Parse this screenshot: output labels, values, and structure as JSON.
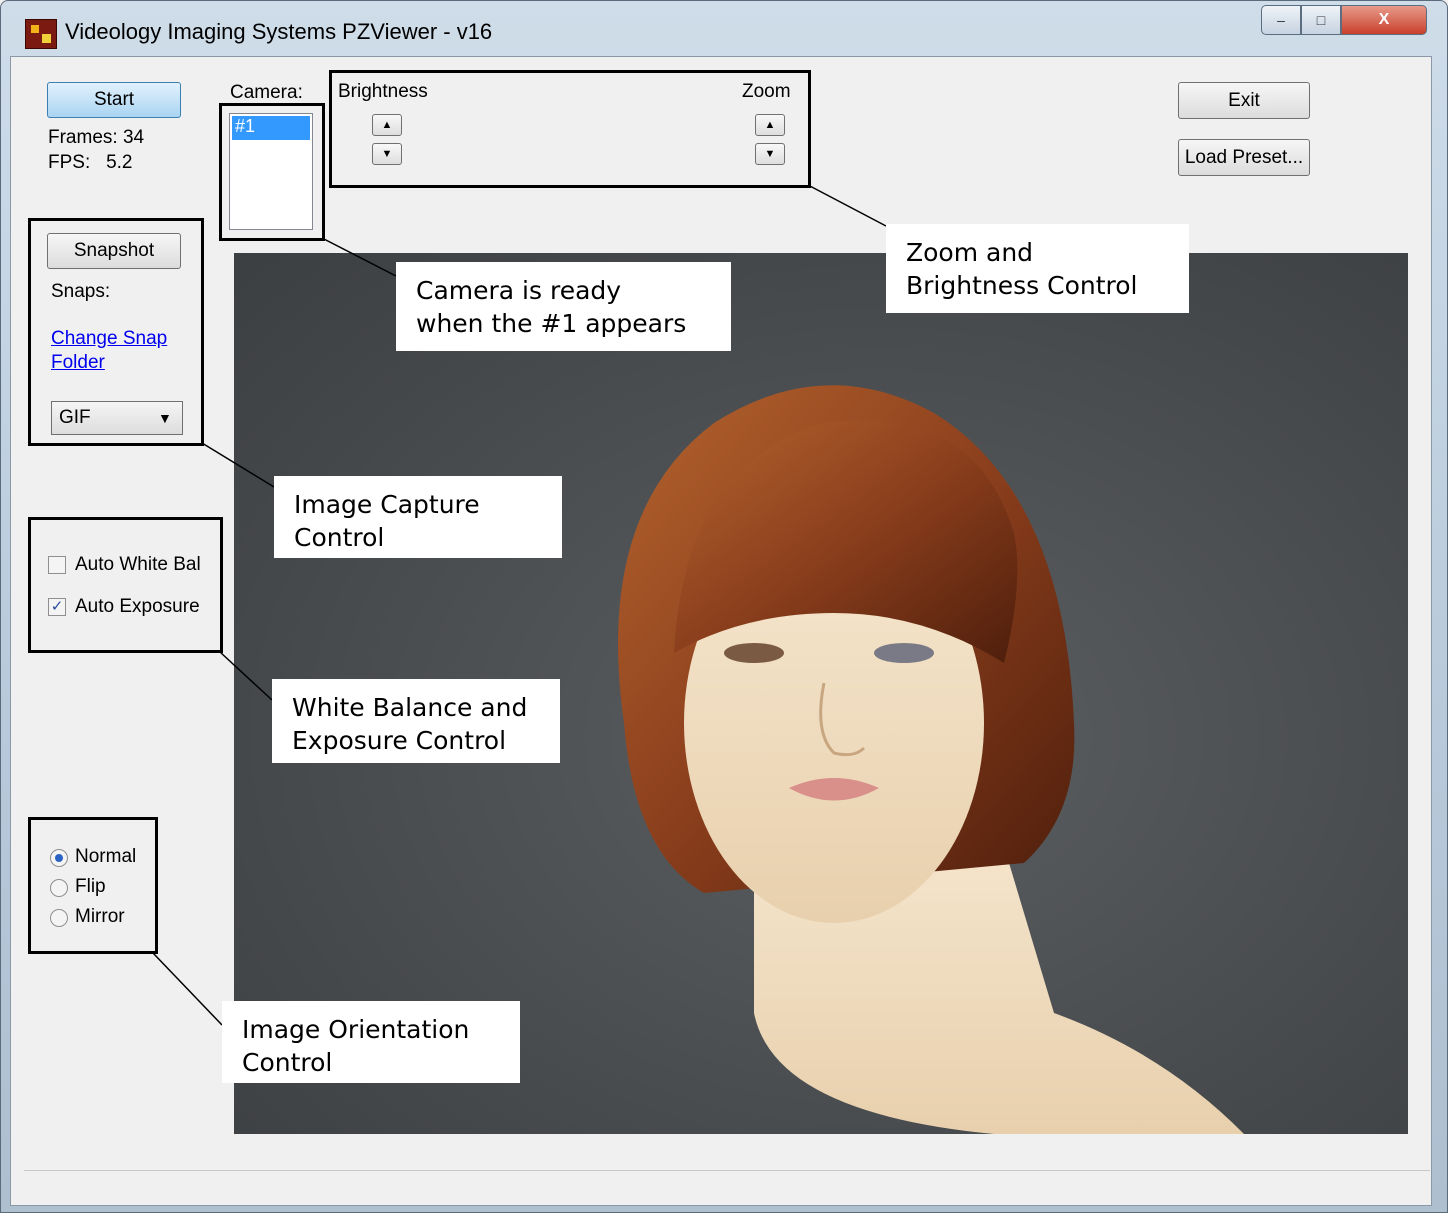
{
  "window": {
    "title": "Videology Imaging Systems PZViewer - v16",
    "controls": {
      "minimize": "–",
      "maximize": "□",
      "close": "X"
    }
  },
  "capture": {
    "start_label": "Start",
    "frames_label": "Frames: 34",
    "fps_label": "FPS:   5.2"
  },
  "camera": {
    "label": "Camera:",
    "items": [
      "#1"
    ]
  },
  "adjust": {
    "brightness_label": "Brightness",
    "zoom_label": "Zoom",
    "up_glyph": "▲",
    "down_glyph": "▼"
  },
  "actions": {
    "exit_label": "Exit",
    "load_preset_label": "Load Preset..."
  },
  "snapshot": {
    "button_label": "Snapshot",
    "snaps_label": "Snaps:",
    "change_folder_label": "Change Snap Folder",
    "format_selected": "GIF",
    "dropdown_glyph": "▼"
  },
  "exposure": {
    "auto_white_bal_label": "Auto White Bal",
    "auto_white_bal_checked": false,
    "auto_exposure_label": "Auto Exposure",
    "auto_exposure_checked": true,
    "check_glyph": "✓"
  },
  "orientation": {
    "options": [
      "Normal",
      "Flip",
      "Mirror"
    ],
    "selected": "Normal"
  },
  "callouts": {
    "camera_ready": "Camera is ready\nwhen the #1 appears",
    "zoom_brightness": "Zoom and\nBrightness Control",
    "image_capture": "Image Capture\nControl",
    "white_balance": "White Balance and\nExposure Control",
    "orientation": "Image Orientation\nControl"
  },
  "colors": {
    "selection": "#3399ff",
    "link": "#0000ee",
    "start_button": "#a9d4f2",
    "hair": "#8a3e1c",
    "skin": "#f1dfc3",
    "backdrop": "#4a4d50"
  }
}
